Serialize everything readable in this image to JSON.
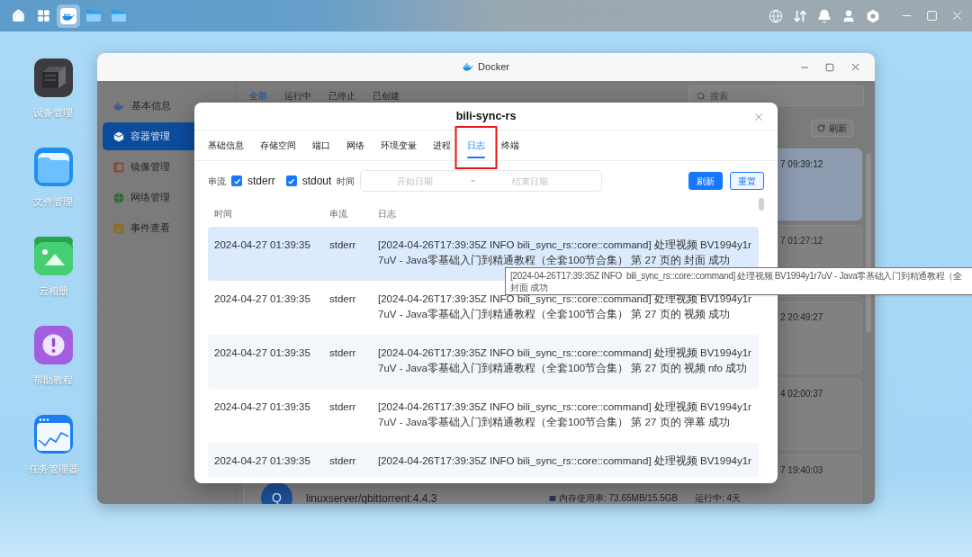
{
  "taskbar": {
    "apps": [
      {
        "kind": "home",
        "selected": false
      },
      {
        "kind": "grid",
        "selected": false
      },
      {
        "kind": "docker",
        "selected": true
      },
      {
        "kind": "folder",
        "selected": false
      },
      {
        "kind": "folder",
        "selected": false
      }
    ]
  },
  "desktop_icons": [
    {
      "label": "设备管理",
      "kind": "device"
    },
    {
      "label": "文件管理",
      "kind": "files"
    },
    {
      "label": "云相册",
      "kind": "photos"
    },
    {
      "label": "帮助教程",
      "kind": "help"
    },
    {
      "label": "任务管理器",
      "kind": "tasks"
    }
  ],
  "docker_window": {
    "title": "Docker",
    "sidebar": [
      {
        "label": "基本信息",
        "kind": "info",
        "selected": false
      },
      {
        "label": "容器管理",
        "kind": "containers",
        "selected": true
      },
      {
        "label": "镜像管理",
        "kind": "images",
        "selected": false
      },
      {
        "label": "网络管理",
        "kind": "network",
        "selected": false
      },
      {
        "label": "事件查看",
        "kind": "events",
        "selected": false
      }
    ],
    "filter_tabs": [
      {
        "label": "全部",
        "selected": true
      },
      {
        "label": "运行中",
        "selected": false
      },
      {
        "label": "已停止",
        "selected": false
      },
      {
        "label": "已创建",
        "selected": false
      }
    ],
    "search": {
      "placeholder": "搜索"
    },
    "refresh_button": "刷新",
    "containers": [
      {
        "time": "7 09:39:12",
        "selected": true
      },
      {
        "time": "7 01:27:12",
        "selected": false
      },
      {
        "time": "2 20:49:27",
        "selected": false
      },
      {
        "time": "4 02:00:37",
        "selected": false
      },
      {
        "time": "7 19:40:03",
        "selected": false,
        "avatar": "Q",
        "image": "linuxserver/qbittorrent:4.4.3",
        "memory": "内存使用率: 73.65MB/15.5GB",
        "status": "运行中: 4天"
      }
    ]
  },
  "modal": {
    "title": "bili-sync-rs",
    "tabs": [
      {
        "label": "基础信息",
        "selected": false,
        "highlighted": false
      },
      {
        "label": "存储空间",
        "selected": false,
        "highlighted": false
      },
      {
        "label": "端口",
        "selected": false,
        "highlighted": false
      },
      {
        "label": "网络",
        "selected": false,
        "highlighted": false
      },
      {
        "label": "环境变量",
        "selected": false,
        "highlighted": false
      },
      {
        "label": "进程",
        "selected": false,
        "highlighted": false
      },
      {
        "label": "日志",
        "selected": true,
        "highlighted": true
      },
      {
        "label": "终端",
        "selected": false,
        "highlighted": false
      }
    ],
    "filter": {
      "stream_label": "串流",
      "streams": [
        {
          "label": "stderr",
          "checked": true
        },
        {
          "label": "stdout",
          "checked": true
        }
      ],
      "time_label": "时间",
      "date_range": {
        "start_placeholder": "开始日期",
        "separator": "~",
        "end_placeholder": "结束日期"
      },
      "buttons": [
        {
          "label": "刷新",
          "kind": "primary"
        },
        {
          "label": "重置",
          "kind": "secondary"
        }
      ]
    },
    "columns": [
      "时间",
      "串流",
      "日志"
    ],
    "rows": [
      {
        "time": "2024-04-27 01:39:35",
        "stream": "stderr",
        "log": "[2024-04-26T17:39:35Z INFO bili_sync_rs::core::command] 处理视频 BV1994y1r7uV - Java零基础入门到精通教程（全套100节合集） 第 27 页的 封面 成功",
        "selected": true
      },
      {
        "time": "2024-04-27 01:39:35",
        "stream": "stderr",
        "log": "[2024-04-26T17:39:35Z INFO bili_sync_rs::core::command] 处理视频 BV1994y1r7uV - Java零基础入门到精通教程（全套100节合集） 第 27 页的 视频 成功",
        "selected": false
      },
      {
        "time": "2024-04-27 01:39:35",
        "stream": "stderr",
        "log": "[2024-04-26T17:39:35Z INFO bili_sync_rs::core::command] 处理视频 BV1994y1r7uV - Java零基础入门到精通教程（全套100节合集） 第 27 页的 视频 nfo 成功",
        "selected": false
      },
      {
        "time": "2024-04-27 01:39:35",
        "stream": "stderr",
        "log": "[2024-04-26T17:39:35Z INFO bili_sync_rs::core::command] 处理视频 BV1994y1r7uV - Java零基础入门到精通教程（全套100节合集） 第 27 页的 弹幕 成功",
        "selected": false
      },
      {
        "time": "2024-04-27 01:39:35",
        "stream": "stderr",
        "log": "[2024-04-26T17:39:35Z INFO bili_sync_rs::core::command] 处理视频 BV1994y1r",
        "selected": false
      }
    ]
  },
  "tooltip": {
    "lines": [
      "[2024-04-26T17:39:35Z INFO  bili_sync_rs::core::command] 处理视频 BV1994y1r7uV - Java零基础入门到精通教程（全",
      "封面 成功"
    ]
  }
}
